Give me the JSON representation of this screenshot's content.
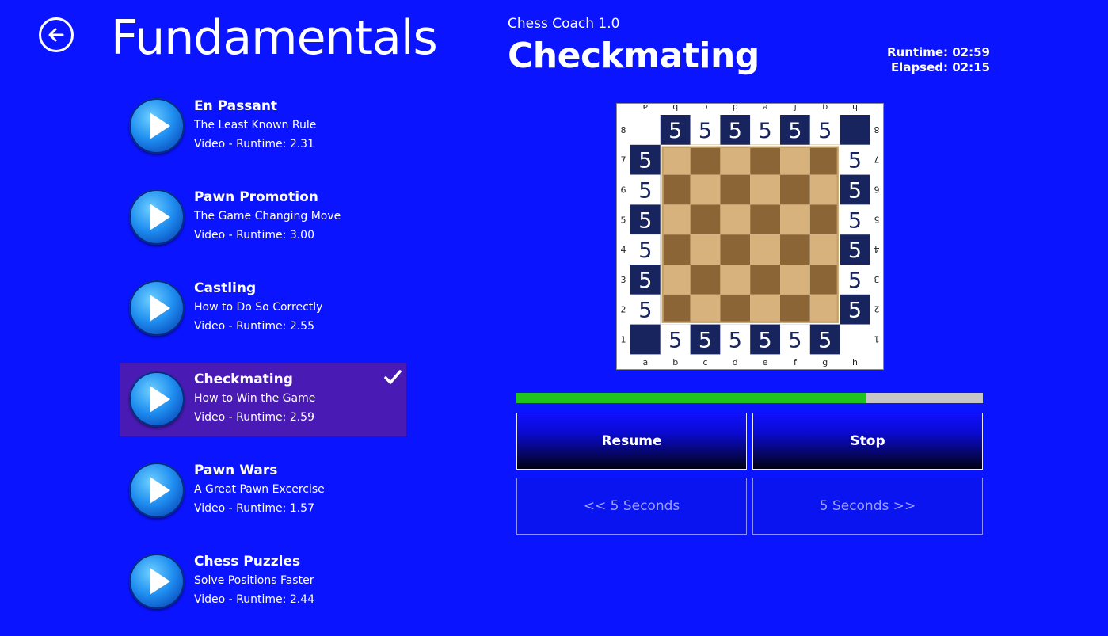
{
  "header": {
    "back_icon": "back-arrow-icon",
    "page_title": "Fundamentals",
    "app_name": "Chess Coach 1.0",
    "lesson_title": "Checkmating",
    "runtime": "Runtime: 02:59",
    "elapsed": "Elapsed: 02:15"
  },
  "lessons": [
    {
      "name": "En Passant",
      "subtitle": "The Least Known Rule",
      "meta": "Video - Runtime: 2.31",
      "selected": false
    },
    {
      "name": "Pawn Promotion",
      "subtitle": "The Game Changing Move",
      "meta": "Video - Runtime: 3.00",
      "selected": false
    },
    {
      "name": "Castling",
      "subtitle": "How to Do So Correctly",
      "meta": "Video - Runtime: 2.55",
      "selected": false
    },
    {
      "name": "Checkmating",
      "subtitle": "How to Win the Game",
      "meta": "Video - Runtime: 2.59",
      "selected": true
    },
    {
      "name": "Pawn Wars",
      "subtitle": "A Great Pawn Excercise",
      "meta": "Video - Runtime: 1.57",
      "selected": false
    },
    {
      "name": "Chess Puzzles",
      "subtitle": "Solve Positions Faster",
      "meta": "Video - Runtime: 2.44",
      "selected": false
    }
  ],
  "board": {
    "files": [
      "a",
      "b",
      "c",
      "d",
      "e",
      "f",
      "g",
      "h"
    ],
    "ranks": [
      "1",
      "2",
      "3",
      "4",
      "5",
      "6",
      "7",
      "8"
    ],
    "piece_glyph": "5",
    "colors": {
      "light": "#d7b27c",
      "dark": "#8b6535",
      "edge_dark": "#17245e",
      "edge_light": "#ffffff"
    }
  },
  "playback": {
    "progress": 0.75,
    "resume_label": "Resume",
    "stop_label": "Stop",
    "rewind_label": "<< 5 Seconds",
    "forward_label": "5 Seconds >>"
  },
  "colors": {
    "background": "#0a14ff",
    "selected": "#4a1ab4",
    "progress": "#1fc41f"
  }
}
